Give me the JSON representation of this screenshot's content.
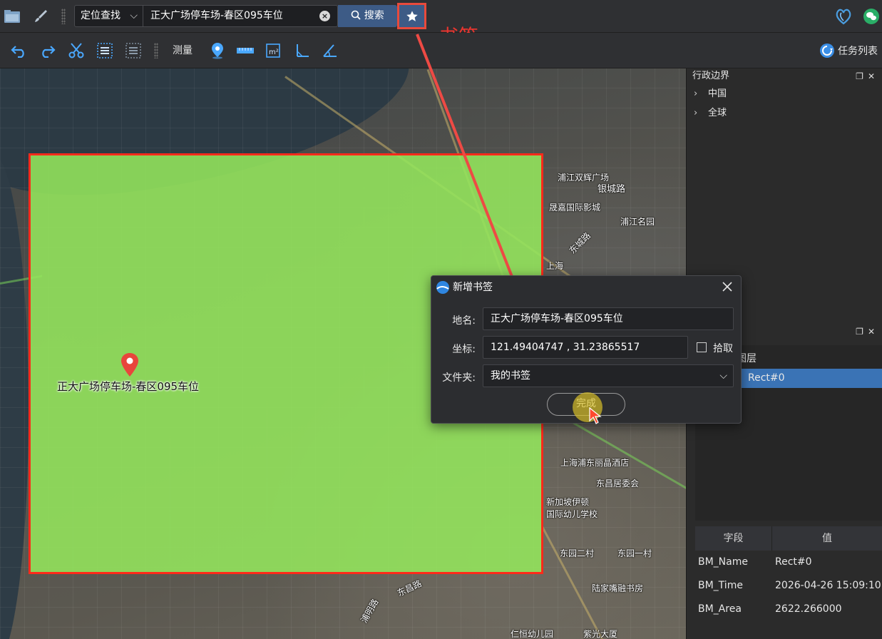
{
  "toolbar": {
    "search_mode": "定位查找",
    "search_value": "正大广场停车场-春区095车位",
    "search_label": "搜索",
    "bookmark_annotation": "书签"
  },
  "toolbar2": {
    "measure_label": "测量",
    "task_list_label": "任务列表"
  },
  "admin_panel": {
    "title": "行政边界",
    "items": [
      {
        "label": "中国"
      },
      {
        "label": "全球"
      }
    ]
  },
  "layers_panel": {
    "group_label": "图层",
    "selected_layer": "Rect#0"
  },
  "attributes": {
    "columns": [
      "字段",
      "值"
    ],
    "rows": [
      {
        "field": "BM_Name",
        "value": "Rect#0"
      },
      {
        "field": "BM_Time",
        "value": "2026-04-26 15:09:10"
      },
      {
        "field": "BM_Area",
        "value": "2622.266000"
      }
    ]
  },
  "map": {
    "pin_label": "正大广场停车场-春区095车位",
    "pois": [
      "浦江双辉广场",
      "银城路",
      "晟嘉国际影城",
      "浦江名园",
      "东城路",
      "上海浦东丽晶酒店",
      "东昌居委会",
      "新加坡伊顿",
      "国际幼儿学校",
      "东园二村",
      "东园一村",
      "陆家嘴融书房",
      "东昌路",
      "浦明路",
      "仁恒幼儿园",
      "紫光大厦",
      "上海"
    ]
  },
  "dialog": {
    "title": "新增书签",
    "name_label": "地名:",
    "name_value": "正大广场停车场-春区095车位",
    "coord_label": "坐标:",
    "coord_value": "121.49404747 , 31.23865517",
    "pick_label": "拾取",
    "folder_label": "文件夹:",
    "folder_value": "我的书签",
    "done_label": "完成"
  },
  "colors": {
    "accent": "#3d5b86",
    "annotation": "#e8352f",
    "overlay_fill": "#94e65c",
    "overlay_border": "#ff2a1a",
    "selection": "#3a73b5"
  }
}
